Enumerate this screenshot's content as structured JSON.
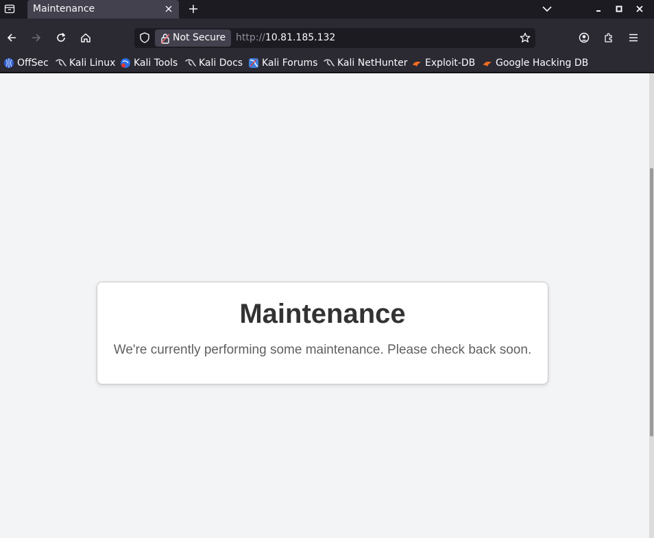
{
  "browser": {
    "tab": {
      "title": "Maintenance"
    },
    "urlbar": {
      "security_label": "Not Secure",
      "url_scheme": "http://",
      "url_host": "10.81.185.132"
    },
    "bookmarks": [
      {
        "label": "OffSec",
        "icon": "offsec-icon"
      },
      {
        "label": "Kali Linux",
        "icon": "kali-dragon-icon"
      },
      {
        "label": "Kali Tools",
        "icon": "kali-tools-icon"
      },
      {
        "label": "Kali Docs",
        "icon": "kali-dragon-icon"
      },
      {
        "label": "Kali Forums",
        "icon": "kali-forums-icon"
      },
      {
        "label": "Kali NetHunter",
        "icon": "kali-dragon-icon"
      },
      {
        "label": "Exploit-DB",
        "icon": "exploit-db-icon"
      },
      {
        "label": "Google Hacking DB",
        "icon": "exploit-db-icon"
      }
    ]
  },
  "page": {
    "title": "Maintenance",
    "message": "We're currently performing some maintenance. Please check back soon."
  },
  "colors": {
    "chrome_dark": "#1c1b22",
    "toolbar": "#2b2a33",
    "content_bg": "#f3f4f6",
    "card_bg": "#ffffff",
    "title_text": "#333333",
    "message_text": "#5f5f5f"
  }
}
